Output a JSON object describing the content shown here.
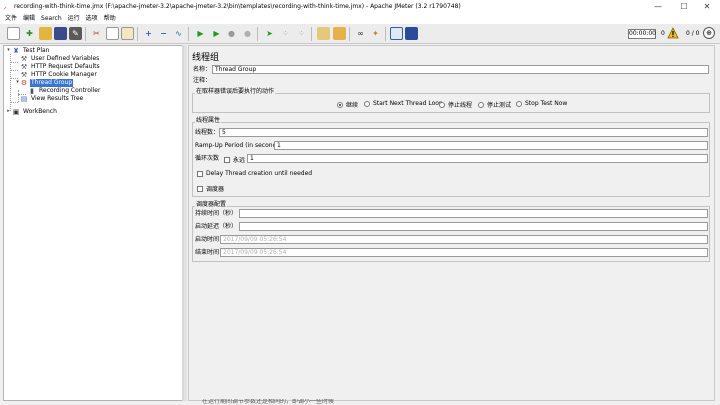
{
  "window": {
    "title": "recording-with-think-time.jmx (F:\\apache-jmeter-3.2\\apache-jmeter-3.2\\bin\\templates\\recording-with-think-time.jmx) - Apache JMeter (3.2 r1790748)",
    "minimize": "—",
    "maximize": "☐",
    "close": "✕"
  },
  "menu": [
    "文件",
    "编辑",
    "Search",
    "运行",
    "选项",
    "帮助"
  ],
  "toolbar": {
    "icons": [
      "new-icon",
      "templates-icon",
      "open-icon",
      "save-icon",
      "save-as-icon",
      "cut-icon",
      "copy-icon",
      "paste-icon",
      "expand-icon",
      "collapse-icon",
      "toggle-icon",
      "start-icon",
      "start-no-pause-icon",
      "stop-icon",
      "shutdown-icon",
      "remote-start-icon",
      "remote-stop-icon",
      "remote-shutdown-icon",
      "clear-icon",
      "clear-all-icon",
      "search-icon",
      "reset-search-icon",
      "function-helper-icon",
      "help-icon"
    ],
    "timer": "00:00:00",
    "warning_count": "0",
    "thread_count": "0 / 0"
  },
  "tree": {
    "test_plan": "Test Plan",
    "user_defined_variables": "User Defined Variables",
    "http_request_defaults": "HTTP Request Defaults",
    "http_cookie_manager": "HTTP Cookie Manager",
    "thread_group": "Thread Group",
    "recording_controller": "Recording Controller",
    "view_results_tree": "View Results Tree",
    "workbench": "WorkBench"
  },
  "panel": {
    "title": "线程组",
    "name_label": "名称：",
    "name_value": "Thread Group",
    "comment_label": "注释：",
    "comment_value": "",
    "error_action": {
      "title": "在取样器错误后要执行的动作",
      "options": [
        {
          "label": "继续",
          "selected": true
        },
        {
          "label": "Start Next Thread Loop",
          "selected": false
        },
        {
          "label": "停止线程",
          "selected": false
        },
        {
          "label": "停止测试",
          "selected": false
        },
        {
          "label": "Stop Test Now",
          "selected": false
        }
      ]
    },
    "thread_props": {
      "title": "线程属性",
      "threads_label": "线程数：",
      "threads_value": "5",
      "rampup_label": "Ramp-Up Period (in seconds):",
      "rampup_value": "1",
      "loop_label": "循环次数",
      "forever_label": "永远",
      "loop_value": "1",
      "delay_label": "Delay Thread creation until needed",
      "scheduler_label": "调度器"
    },
    "scheduler": {
      "title": "调度器配置",
      "duration_label": "持续时间（秒）",
      "duration_value": "",
      "startup_delay_label": "启动延迟（秒）",
      "startup_delay_value": "",
      "start_time_label": "启动时间",
      "start_time_value": "2017/09/09 05:26:54",
      "end_time_label": "结束时间",
      "end_time_value": "2017/09/09 05:26:54"
    }
  },
  "status_text": "在运行期间调节参数还是相同的，即调小一些时候"
}
